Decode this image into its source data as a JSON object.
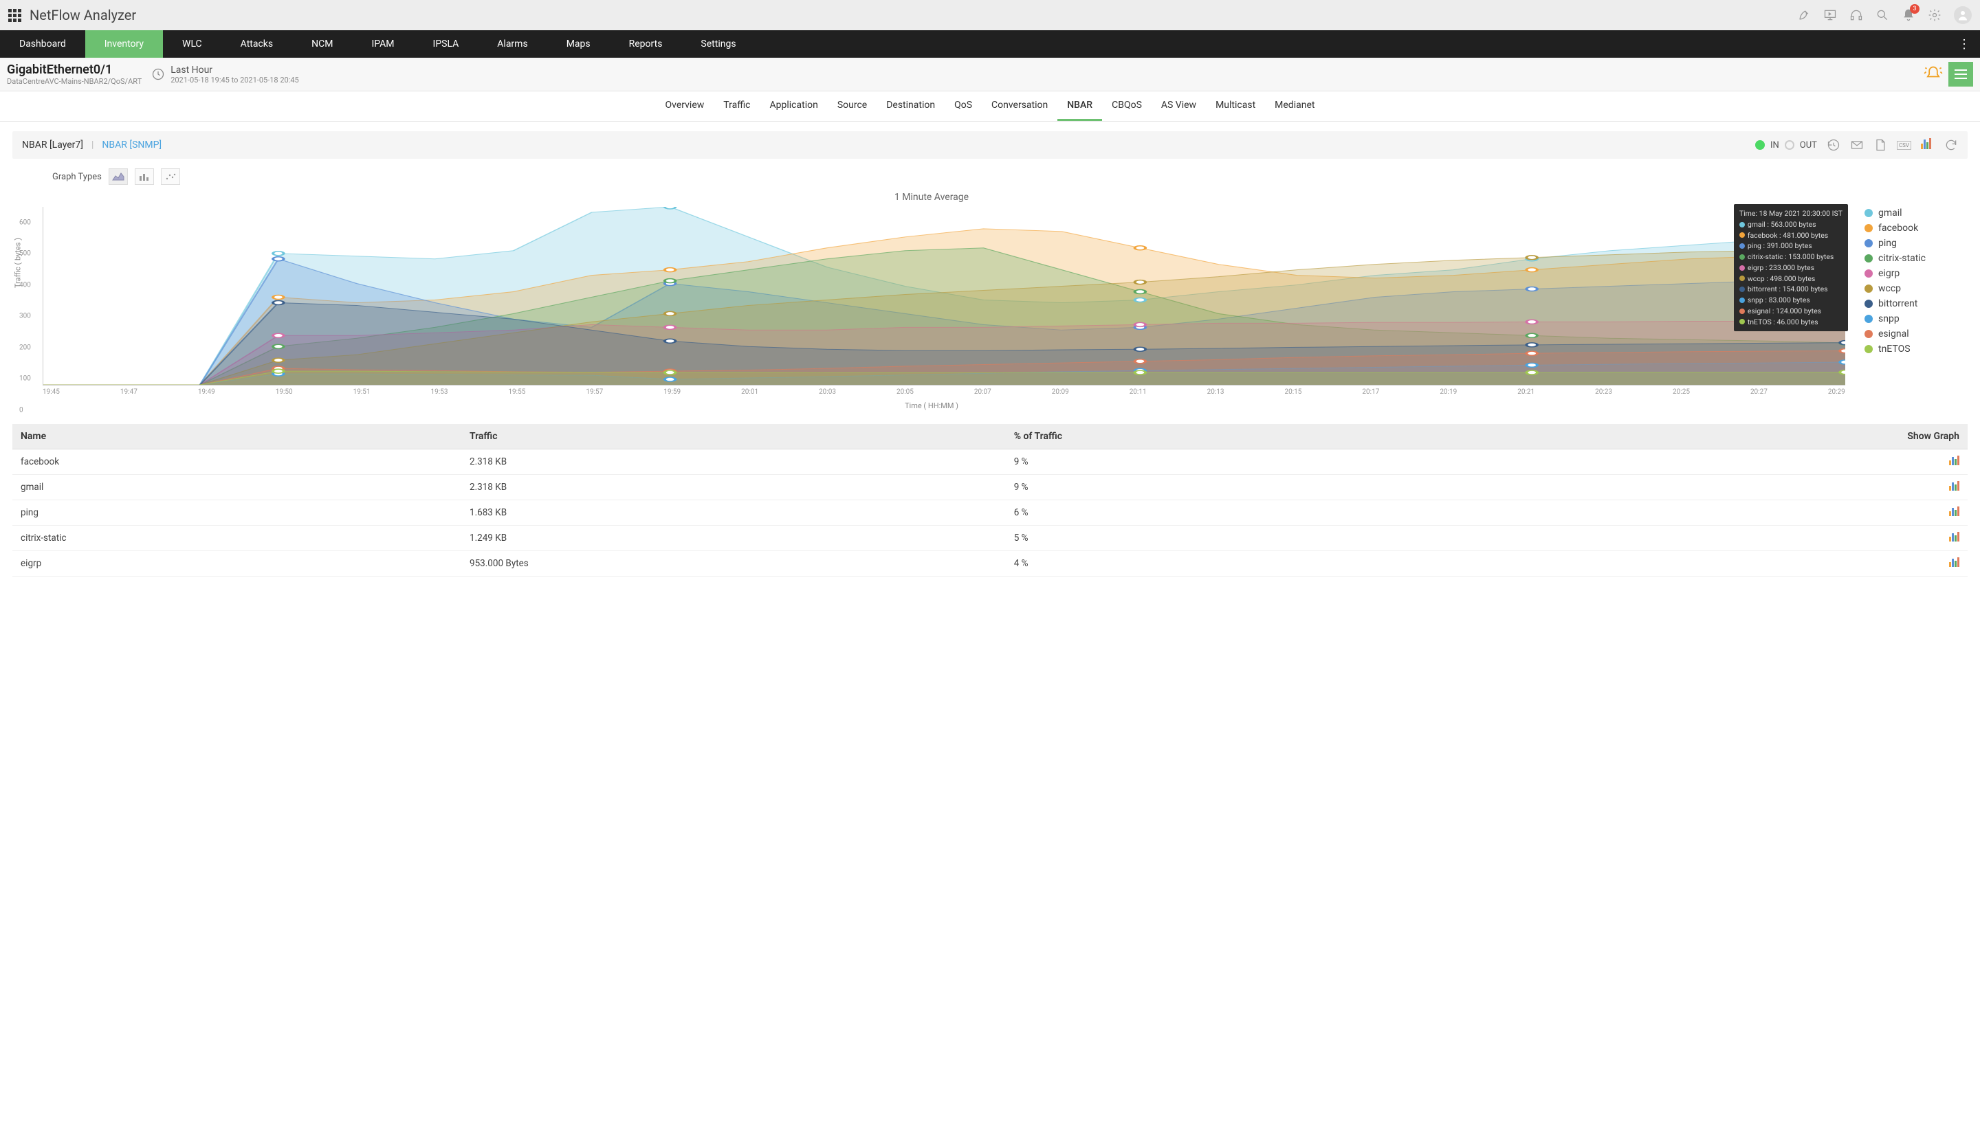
{
  "app": {
    "title": "NetFlow Analyzer"
  },
  "notifications": {
    "count": "3"
  },
  "mainnav": {
    "items": [
      "Dashboard",
      "Inventory",
      "WLC",
      "Attacks",
      "NCM",
      "IPAM",
      "IPSLA",
      "Alarms",
      "Maps",
      "Reports",
      "Settings"
    ],
    "active": 1
  },
  "interface": {
    "name": "GigabitEthernet0/1",
    "path": "DataCentreAVC-Mains-NBAR2/QoS/ART",
    "time_label": "Last Hour",
    "time_range": "2021-05-18 19:45 to 2021-05-18 20:45"
  },
  "tabs2": {
    "items": [
      "Overview",
      "Traffic",
      "Application",
      "Source",
      "Destination",
      "QoS",
      "Conversation",
      "NBAR",
      "CBQoS",
      "AS View",
      "Multicast",
      "Medianet"
    ],
    "active": 7
  },
  "toolbar": {
    "mode_a": "NBAR [Layer7]",
    "sep": "|",
    "mode_b": "NBAR [SNMP]",
    "in": "IN",
    "out": "OUT"
  },
  "graph_types_label": "Graph Types",
  "chart_data": {
    "type": "area",
    "title": "1 Minute Average",
    "xlabel": "Time ( HH:MM )",
    "ylabel": "Traffic ( bytes )",
    "ylim": [
      0,
      650
    ],
    "yticks": [
      0,
      100,
      200,
      300,
      400,
      500,
      600
    ],
    "categories": [
      "19:45",
      "19:47",
      "19:49",
      "19:50",
      "19:51",
      "19:53",
      "19:55",
      "19:57",
      "19:59",
      "20:01",
      "20:03",
      "20:05",
      "20:07",
      "20:09",
      "20:11",
      "20:13",
      "20:15",
      "20:17",
      "20:19",
      "20:21",
      "20:23",
      "20:25",
      "20:27",
      "20:29"
    ],
    "series": [
      {
        "name": "gmail",
        "color": "#6fc7dd",
        "values": [
          0,
          0,
          0,
          480,
          470,
          460,
          490,
          630,
          650,
          540,
          430,
          360,
          310,
          300,
          310,
          340,
          365,
          400,
          420,
          460,
          490,
          510,
          530,
          563
        ]
      },
      {
        "name": "facebook",
        "color": "#f2a43b",
        "values": [
          0,
          0,
          0,
          320,
          300,
          310,
          340,
          400,
          420,
          450,
          500,
          540,
          570,
          560,
          500,
          440,
          400,
          390,
          400,
          420,
          440,
          460,
          470,
          481
        ]
      },
      {
        "name": "ping",
        "color": "#5b8fd6",
        "values": [
          0,
          0,
          0,
          460,
          370,
          300,
          240,
          210,
          370,
          340,
          300,
          260,
          220,
          200,
          210,
          240,
          280,
          320,
          340,
          350,
          360,
          370,
          380,
          391
        ]
      },
      {
        "name": "citrix-static",
        "color": "#5aa860",
        "values": [
          0,
          0,
          0,
          140,
          170,
          210,
          260,
          320,
          380,
          420,
          460,
          490,
          500,
          420,
          340,
          260,
          220,
          200,
          190,
          180,
          170,
          165,
          160,
          153
        ]
      },
      {
        "name": "eigrp",
        "color": "#d66fa8",
        "values": [
          0,
          0,
          0,
          180,
          180,
          190,
          200,
          220,
          210,
          200,
          200,
          210,
          210,
          215,
          220,
          225,
          225,
          228,
          228,
          230,
          230,
          232,
          232,
          233
        ]
      },
      {
        "name": "wccp",
        "color": "#b89a3e",
        "values": [
          0,
          0,
          0,
          90,
          110,
          150,
          190,
          230,
          260,
          290,
          310,
          330,
          345,
          360,
          375,
          395,
          420,
          440,
          455,
          465,
          475,
          485,
          490,
          498
        ]
      },
      {
        "name": "bittorrent",
        "color": "#3b5f8a",
        "values": [
          0,
          0,
          0,
          300,
          290,
          265,
          240,
          200,
          160,
          140,
          130,
          125,
          125,
          128,
          130,
          133,
          137,
          140,
          143,
          146,
          148,
          150,
          152,
          154
        ]
      },
      {
        "name": "snpp",
        "color": "#4aa3df",
        "values": [
          0,
          0,
          0,
          40,
          40,
          38,
          36,
          35,
          20,
          25,
          30,
          36,
          42,
          48,
          52,
          56,
          60,
          64,
          68,
          72,
          75,
          78,
          80,
          83
        ]
      },
      {
        "name": "esignal",
        "color": "#e07b5a",
        "values": [
          0,
          0,
          0,
          60,
          55,
          52,
          48,
          46,
          50,
          54,
          60,
          68,
          74,
          80,
          86,
          92,
          100,
          106,
          110,
          115,
          118,
          121,
          123,
          124
        ]
      },
      {
        "name": "tnETOS",
        "color": "#a0c850",
        "values": [
          0,
          0,
          0,
          50,
          50,
          48,
          47,
          46,
          45,
          45,
          44,
          44,
          44,
          45,
          45,
          45,
          45,
          45,
          45,
          45,
          46,
          46,
          46,
          46
        ]
      }
    ],
    "tooltip": {
      "time": "Time: 18 May 2021 20:30:00 IST",
      "rows": [
        {
          "color": "#6fc7dd",
          "label": "gmail : 563.000 bytes"
        },
        {
          "color": "#f2a43b",
          "label": "facebook : 481.000 bytes"
        },
        {
          "color": "#5b8fd6",
          "label": "ping : 391.000 bytes"
        },
        {
          "color": "#5aa860",
          "label": "citrix-static : 153.000 bytes"
        },
        {
          "color": "#d66fa8",
          "label": "eigrp : 233.000 bytes"
        },
        {
          "color": "#b89a3e",
          "label": "wccp : 498.000 bytes"
        },
        {
          "color": "#3b5f8a",
          "label": "bittorrent : 154.000 bytes"
        },
        {
          "color": "#4aa3df",
          "label": "snpp : 83.000 bytes"
        },
        {
          "color": "#e07b5a",
          "label": "esignal : 124.000 bytes"
        },
        {
          "color": "#a0c850",
          "label": "tnETOS : 46.000 bytes"
        }
      ]
    }
  },
  "table": {
    "headers": {
      "name": "Name",
      "traffic": "Traffic",
      "pct": "% of Traffic",
      "graph": "Show Graph"
    },
    "rows": [
      {
        "name": "facebook",
        "traffic": "2.318 KB",
        "pct": "9 %"
      },
      {
        "name": "gmail",
        "traffic": "2.318 KB",
        "pct": "9 %"
      },
      {
        "name": "ping",
        "traffic": "1.683 KB",
        "pct": "6 %"
      },
      {
        "name": "citrix-static",
        "traffic": "1.249 KB",
        "pct": "5 %"
      },
      {
        "name": "eigrp",
        "traffic": "953.000 Bytes",
        "pct": "4 %"
      }
    ]
  }
}
